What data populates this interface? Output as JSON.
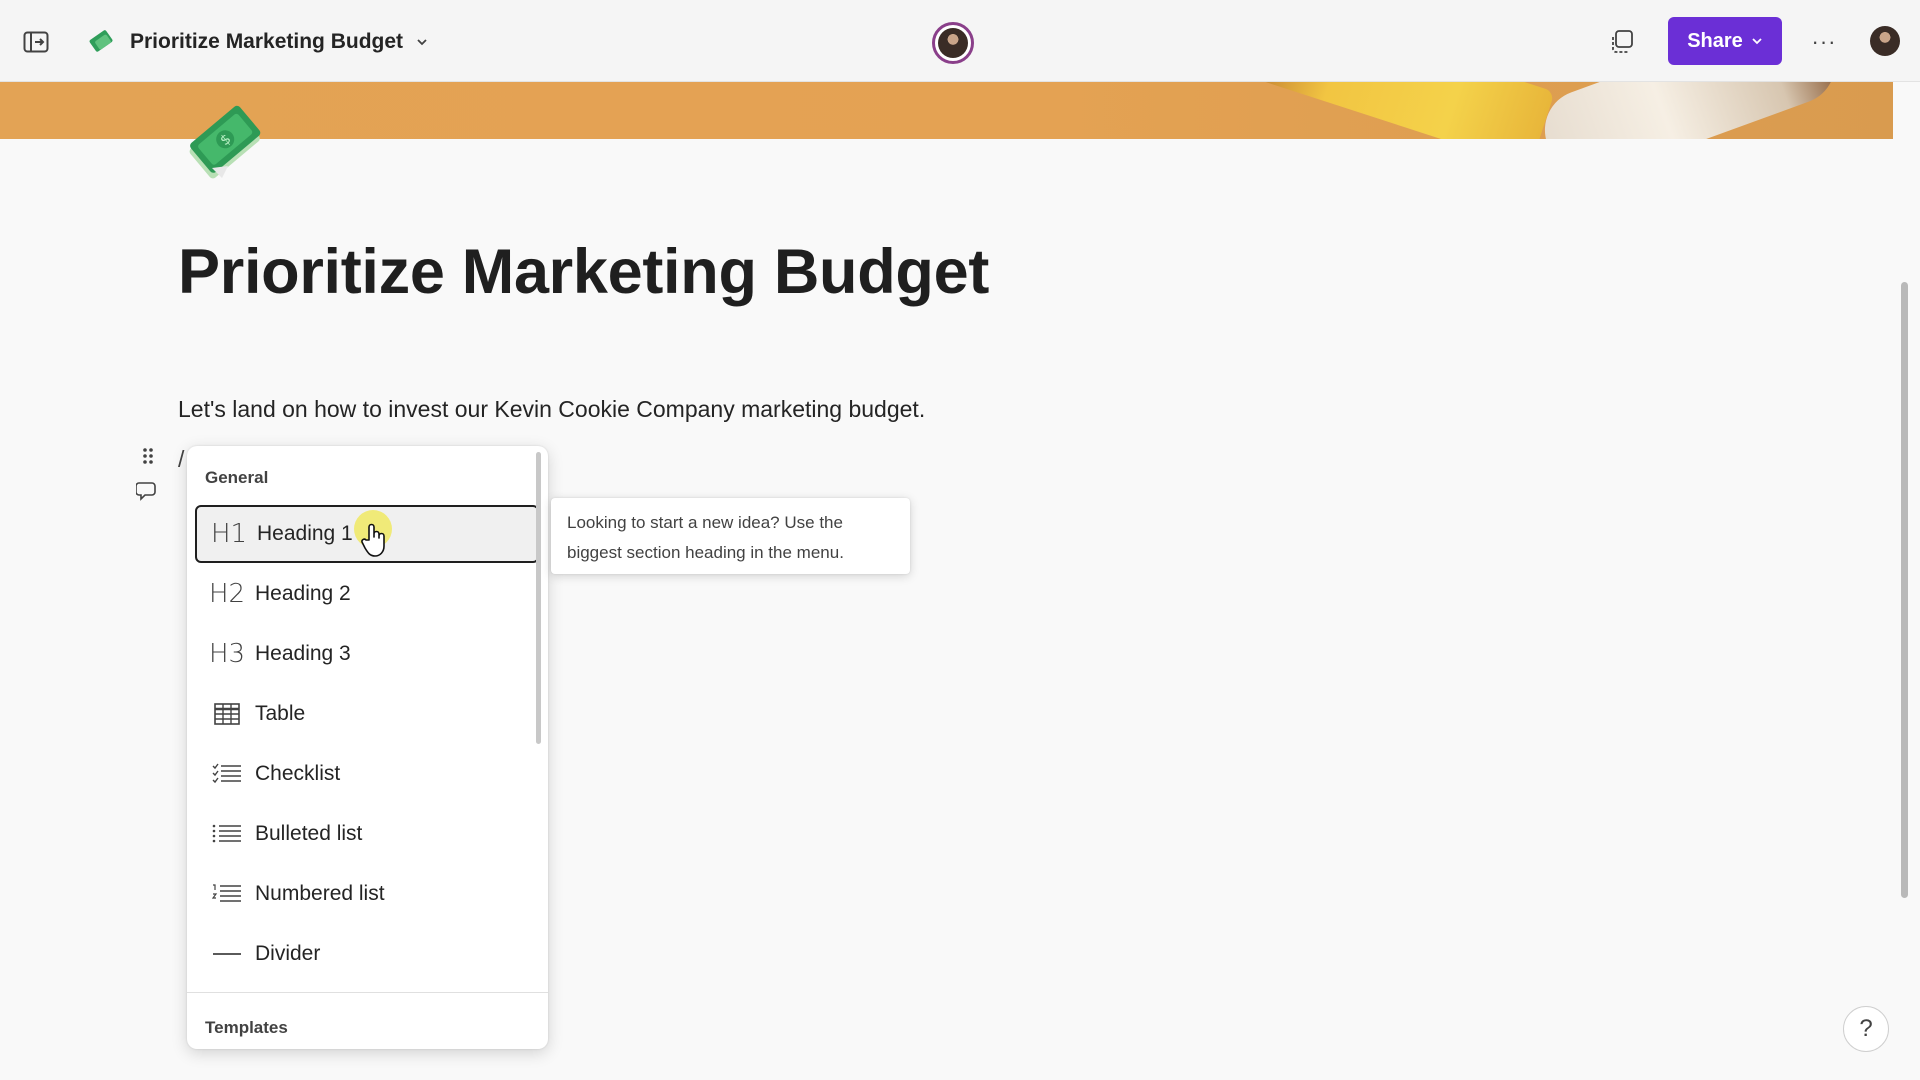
{
  "header": {
    "document_title": "Prioritize Marketing Budget",
    "share_label": "Share",
    "more_label": "···"
  },
  "page": {
    "title": "Prioritize Marketing Budget",
    "intro": "Let's land on how to invest our Kevin Cookie Company marketing budget.",
    "slash_input": "/"
  },
  "slash_menu": {
    "section_general": "General",
    "items": [
      {
        "icon": "H1",
        "label": "Heading 1"
      },
      {
        "icon": "H2",
        "label": "Heading 2"
      },
      {
        "icon": "H3",
        "label": "Heading 3"
      },
      {
        "icon": "table-icon",
        "label": "Table"
      },
      {
        "icon": "checklist-icon",
        "label": "Checklist"
      },
      {
        "icon": "bulleted-list-icon",
        "label": "Bulleted list"
      },
      {
        "icon": "numbered-list-icon",
        "label": "Numbered list"
      },
      {
        "icon": "divider-icon",
        "label": "Divider"
      }
    ],
    "active_item": "Heading 1",
    "section_templates": "Templates"
  },
  "tooltip": {
    "text": "Looking to start a new idea? Use the biggest section heading in the menu."
  },
  "help": {
    "label": "?"
  },
  "colors": {
    "share_button": "#6b2fd6",
    "cover": "#e3a355",
    "presence_ring": "#8a3f8a"
  }
}
